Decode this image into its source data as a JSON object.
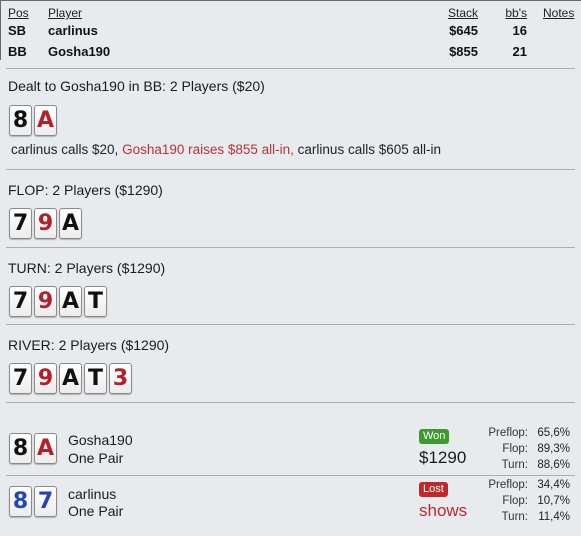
{
  "players_table": {
    "headers": {
      "pos": "Pos",
      "player": "Player",
      "stack": "Stack",
      "bbs": "bb's",
      "notes": "Notes"
    },
    "rows": [
      {
        "pos": "SB",
        "player": "carlinus",
        "stack": "$645",
        "bbs": "16"
      },
      {
        "pos": "BB",
        "player": "Gosha190",
        "stack": "$855",
        "bbs": "21"
      }
    ]
  },
  "preflop": {
    "heading": "Dealt to Gosha190 in BB: 2 Players ($20)",
    "cards": [
      {
        "rank": "8",
        "suit_color": "black"
      },
      {
        "rank": "A",
        "suit_color": "red"
      }
    ],
    "actions": {
      "part1": "carlinus calls $20, ",
      "part2": "Gosha190 raises $855 all-in,",
      "part3": " carlinus calls $605 all-in"
    }
  },
  "flop": {
    "heading": "FLOP: 2 Players ($1290)",
    "cards": [
      {
        "rank": "7",
        "suit_color": "black"
      },
      {
        "rank": "9",
        "suit_color": "red"
      },
      {
        "rank": "A",
        "suit_color": "black"
      }
    ]
  },
  "turn": {
    "heading": "TURN: 2 Players ($1290)",
    "cards": [
      {
        "rank": "7",
        "suit_color": "black"
      },
      {
        "rank": "9",
        "suit_color": "red"
      },
      {
        "rank": "A",
        "suit_color": "black"
      },
      {
        "rank": "T",
        "suit_color": "black"
      }
    ]
  },
  "river": {
    "heading": "RIVER: 2 Players ($1290)",
    "cards": [
      {
        "rank": "7",
        "suit_color": "black"
      },
      {
        "rank": "9",
        "suit_color": "red"
      },
      {
        "rank": "A",
        "suit_color": "black"
      },
      {
        "rank": "T",
        "suit_color": "black"
      },
      {
        "rank": "3",
        "suit_color": "red"
      }
    ]
  },
  "results": [
    {
      "player": "Gosha190",
      "hand": "One Pair",
      "cards": [
        {
          "rank": "8",
          "suit_color": "black"
        },
        {
          "rank": "A",
          "suit_color": "red"
        }
      ],
      "badge": "Won",
      "amount": "$1290",
      "amount_color": "#1b1b1b",
      "equity": [
        {
          "label": "Preflop:",
          "value": "65,6%"
        },
        {
          "label": "Flop:",
          "value": "89,3%"
        },
        {
          "label": "Turn:",
          "value": "88,6%"
        }
      ]
    },
    {
      "player": "carlinus",
      "hand": "One Pair",
      "cards": [
        {
          "rank": "8",
          "suit_color": "blue"
        },
        {
          "rank": "7",
          "suit_color": "blue"
        }
      ],
      "badge": "Lost",
      "amount": "shows",
      "amount_color": "#c0282f",
      "equity": [
        {
          "label": "Preflop:",
          "value": "34,4%"
        },
        {
          "label": "Flop:",
          "value": "10,7%"
        },
        {
          "label": "Turn:",
          "value": "11,4%"
        }
      ]
    }
  ],
  "colors": {
    "background": "#e8ebee",
    "card_black": "#111111",
    "card_red": "#b51f29",
    "card_blue": "#2244b8",
    "won_badge": "#3f9a2e",
    "lost_badge": "#c2282a",
    "raise_text": "#b8323b"
  }
}
